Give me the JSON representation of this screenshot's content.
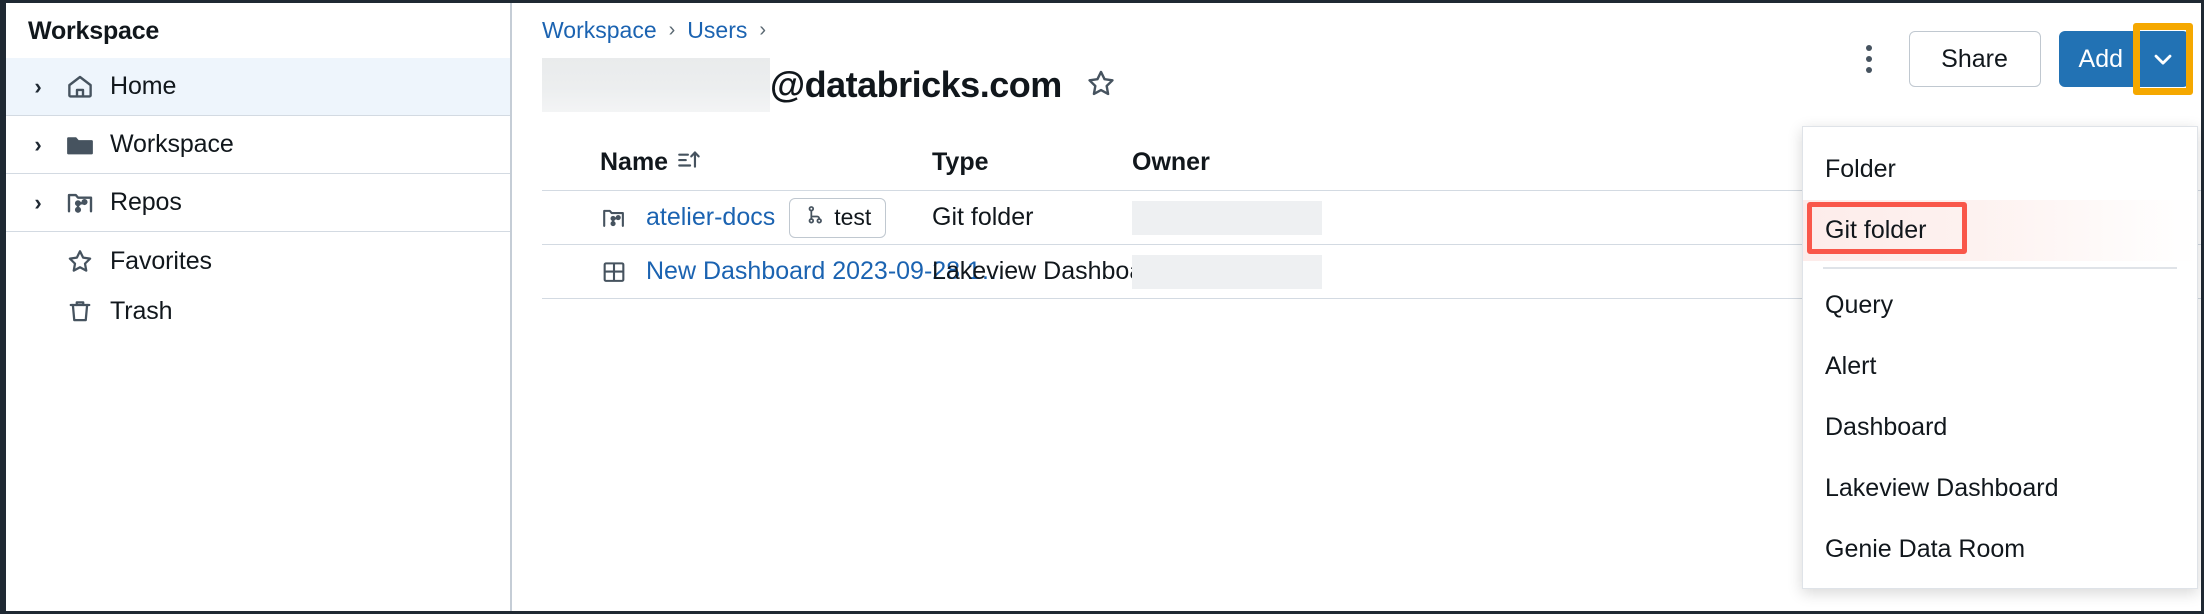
{
  "sidebar": {
    "title": "Workspace",
    "items": [
      {
        "label": "Home",
        "icon": "home-icon",
        "expandable": true,
        "selected": true
      },
      {
        "label": "Workspace",
        "icon": "folder-icon",
        "expandable": true,
        "selected": false
      },
      {
        "label": "Repos",
        "icon": "repo-icon",
        "expandable": true,
        "selected": false
      },
      {
        "label": "Favorites",
        "icon": "star-icon",
        "expandable": false,
        "selected": false
      },
      {
        "label": "Trash",
        "icon": "trash-icon",
        "expandable": false,
        "selected": false
      }
    ]
  },
  "breadcrumb": {
    "items": [
      "Workspace",
      "Users"
    ],
    "separator": "›",
    "trailing_separator": "›"
  },
  "header": {
    "title": "@databricks.com",
    "redacted_prefix": "",
    "star_icon": "star-outline-icon",
    "kebab_icon": "more-vertical-icon",
    "share_label": "Share",
    "add_label": "Add",
    "add_caret_icon": "chevron-down-icon",
    "highlight_color": "#f5a800",
    "accent_color": "#2272b4",
    "link_color": "#1b63b1"
  },
  "table": {
    "columns": [
      "Name",
      "Type",
      "Owner"
    ],
    "sort_icon": "sort-ascending-icon",
    "rows": [
      {
        "icon": "git-folder-icon",
        "name": "atelier-docs",
        "badge": "test",
        "badge_icon": "git-branch-icon",
        "type": "Git folder",
        "owner": ""
      },
      {
        "icon": "dashboard-icon",
        "name": "New Dashboard 2023-09-28 1…",
        "badge": null,
        "badge_icon": null,
        "type": "Lakeview Dashboa…",
        "owner": ""
      }
    ]
  },
  "add_menu": {
    "items": [
      {
        "label": "Folder",
        "highlighted": false,
        "divider_after": false
      },
      {
        "label": "Git folder",
        "highlighted": true,
        "divider_after": true
      },
      {
        "label": "Query",
        "highlighted": false,
        "divider_after": false
      },
      {
        "label": "Alert",
        "highlighted": false,
        "divider_after": false
      },
      {
        "label": "Dashboard",
        "highlighted": false,
        "divider_after": false
      },
      {
        "label": "Lakeview Dashboard",
        "highlighted": false,
        "divider_after": false
      },
      {
        "label": "Genie Data Room",
        "highlighted": false,
        "divider_after": false
      }
    ],
    "highlight_box_color": "#f9574a"
  }
}
